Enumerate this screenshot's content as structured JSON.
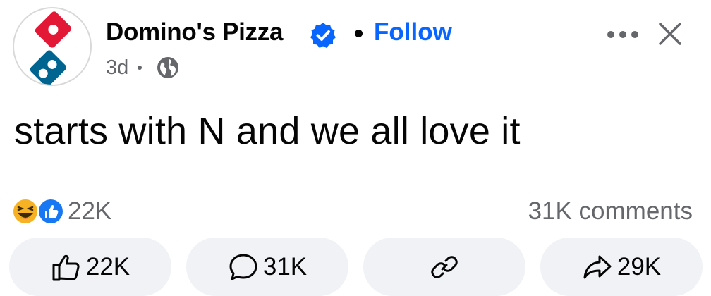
{
  "post": {
    "author": "Domino's Pizza",
    "follow_label": "Follow",
    "time": "3d",
    "text": "starts with N and we all love it",
    "reaction_count": "22K",
    "comments_summary": "31K comments"
  },
  "actions": {
    "like_count": "22K",
    "comment_count": "31K",
    "share_count": "29K"
  },
  "icons": {
    "verified": "verified-badge-icon",
    "audience": "globe-icon",
    "more": "more-options-icon",
    "close": "close-icon",
    "reactions": [
      "haha-reaction-icon",
      "like-reaction-icon"
    ],
    "like": "thumbs-up-icon",
    "comment": "comment-bubble-icon",
    "link": "link-icon",
    "share": "share-arrow-icon"
  },
  "colors": {
    "accent": "#0866ff",
    "secondary_text": "#65676b",
    "button_bg": "#f0f2f5",
    "domino_blue": "#006491",
    "domino_red": "#e31837"
  }
}
